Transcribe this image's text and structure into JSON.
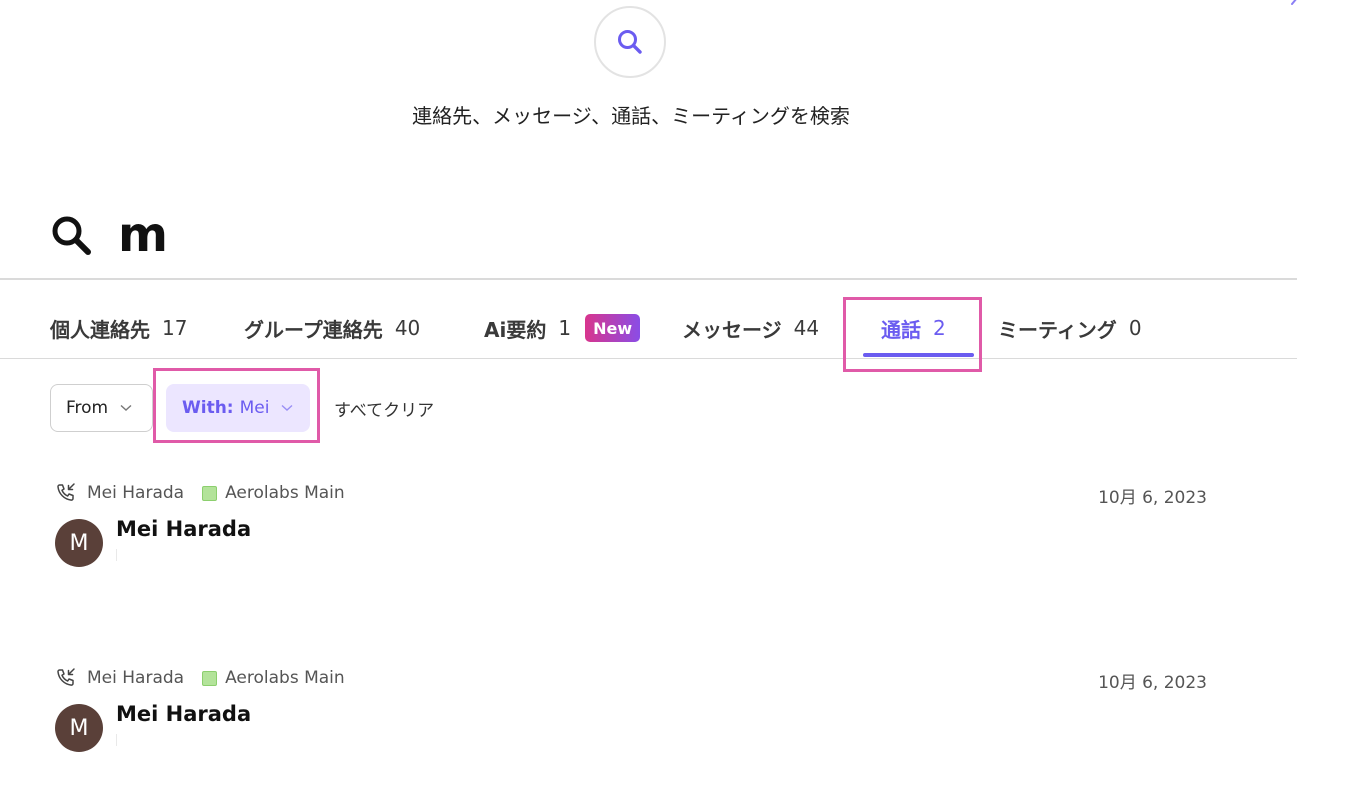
{
  "hero": {
    "description": "連絡先、メッセージ、通話、ミーティングを検索",
    "icon": "search-icon",
    "accent": "#6b5cf0"
  },
  "search": {
    "query": "m",
    "icon": "search-icon"
  },
  "tabs": [
    {
      "label": "個人連絡先",
      "count": "17"
    },
    {
      "label": "グループ連絡先",
      "count": "40"
    },
    {
      "label": "Ai要約",
      "count": "1",
      "badge": "New"
    },
    {
      "label": "メッセージ",
      "count": "44"
    },
    {
      "label": "通話",
      "count": "2",
      "active": true
    },
    {
      "label": "ミーティング",
      "count": "0"
    }
  ],
  "filters": {
    "from_label": "From",
    "with_key": "With:",
    "with_value": "Mei",
    "clear_all": "すべてクリア"
  },
  "calls": [
    {
      "icon": "incoming-call-icon",
      "contact": "Mei Harada",
      "line": "Aerolabs Main",
      "date": "10月 6, 2023",
      "avatar_letter": "M",
      "title": "Mei Harada"
    },
    {
      "icon": "incoming-call-icon",
      "contact": "Mei Harada",
      "line": "Aerolabs Main",
      "date": "10月 6, 2023",
      "avatar_letter": "M",
      "title": "Mei Harada"
    }
  ],
  "colors": {
    "accent": "#6b5cf0",
    "highlight": "#e05aa8",
    "line_tag": "#b3e39a",
    "avatar": "#5a4039"
  }
}
